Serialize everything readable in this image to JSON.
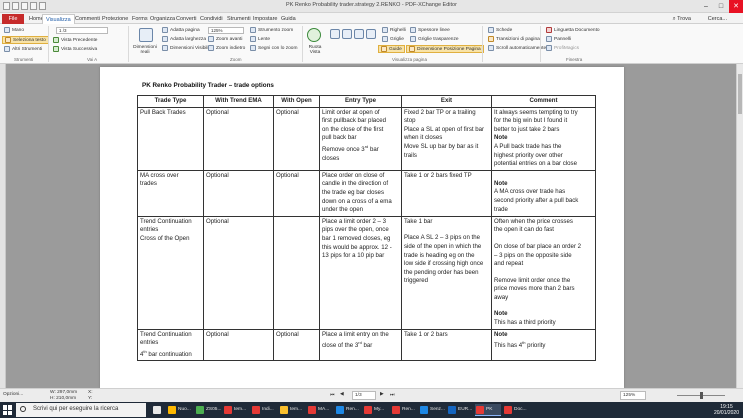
{
  "window": {
    "title": "PK Renko Probability trader.strategy 2.RENKO - PDF-XChange Editor",
    "tabs": [
      "File",
      "Home",
      "Visualizza",
      "Commenti",
      "Protezione",
      "Forms",
      "Organizza",
      "Converti",
      "Condividi",
      "Strumenti",
      "Impostare",
      "Guida"
    ],
    "search_label": "Cerca...",
    "find_label": "Trova"
  },
  "ribbon": {
    "tools": [
      {
        "label": "Mano",
        "icon": "hand-icon"
      },
      {
        "label": "Seleziona testo",
        "icon": "text-select-icon",
        "highlighted": true
      },
      {
        "label": "Altri Strumenti",
        "icon": "more-tools-icon"
      },
      {
        "label": "Vista Precedente",
        "icon": "previous-view-icon"
      },
      {
        "label": "Vista Successiva",
        "icon": "next-view-icon"
      }
    ],
    "page_field": "1",
    "page_total": "/3",
    "zoom_buttons": [
      {
        "label": "Adatta pagina",
        "icon": "fit-page-icon"
      },
      {
        "label": "Adatta larghezza",
        "icon": "fit-width-icon"
      },
      {
        "label": "Dimensioni Visibili",
        "icon": "fit-visible-icon"
      },
      {
        "label": "Zoom avanti",
        "icon": "zoom-in-icon"
      },
      {
        "label": "Zoom indietro",
        "icon": "zoom-out-icon"
      },
      {
        "label": "Strumento zoom",
        "icon": "zoom-tool-icon"
      },
      {
        "label": "Lente",
        "icon": "loupe-icon"
      },
      {
        "label": "Segni con lo zoom",
        "icon": "snapshot-zoom-icon"
      }
    ],
    "zoom_value": "125%",
    "dim_reali": "Dimensioni reali",
    "rotate_view": "Ruota Vista",
    "page_display": [
      {
        "label": "Righelli",
        "icon": "rulers-icon"
      },
      {
        "label": "Griglie",
        "icon": "grid-icon"
      },
      {
        "label": "Guide",
        "icon": "guides-icon",
        "highlighted": true
      },
      {
        "label": "Spessore linee",
        "icon": "line-weight-icon"
      },
      {
        "label": "Griglie trasparenze",
        "icon": "transparency-grid-icon"
      },
      {
        "label": "Dimensione Posizione Pagina",
        "icon": "page-position-icon",
        "highlighted": true
      }
    ],
    "navigation": [
      {
        "label": "Schede",
        "icon": "tabs-icon"
      },
      {
        "label": "Transizioni di pagina",
        "icon": "page-transitions-icon"
      },
      {
        "label": "Scroll automaticamente",
        "icon": "auto-scroll-icon"
      }
    ],
    "panels": [
      {
        "label": "Linguetta Documento",
        "icon": "doc-tab-icon"
      },
      {
        "label": "Pannelli",
        "icon": "panels-icon"
      },
      {
        "label": "ProfiMagics",
        "icon": "profile-icon"
      }
    ],
    "group_labels": [
      "Strumenti",
      "Vai A",
      "Zoom",
      "Visualizza pagina",
      "Finestra"
    ]
  },
  "document": {
    "title": "PK Renko Probability Trader – trade options",
    "headers": [
      "Trade Type",
      "With Trend EMA",
      "With Open",
      "Entry Type",
      "Exit",
      "Comment"
    ],
    "rows": [
      {
        "type": [
          "Pull Back Trades"
        ],
        "ema": "Optional",
        "open": "Optional",
        "entry": [
          "Limit order at open of",
          "first pullback bar placed",
          "on the close of the first",
          "pull back bar",
          "Remove once 3rd bar",
          "closes"
        ],
        "exit": [
          "Fixed 2 bar TP or a trailing",
          "stop",
          "Place a SL at open of first bar",
          "when it closes",
          "Move SL up bar by bar as it",
          "trails"
        ],
        "comment": [
          "It always seems tempting to try",
          "for the big win but I found it",
          "better to just take 2 bars",
          "Note",
          "A Pull back trade has the",
          "highest priority over other",
          "potential entries on a bar close"
        ]
      },
      {
        "type": [
          "MA cross over",
          "trades"
        ],
        "ema": "Optional",
        "open": "Optional",
        "entry": [
          "Place order on close of",
          "candle in the direction of",
          "the trade eg bar closes",
          "down on a cross of a ema",
          "under the open"
        ],
        "exit": [
          "Take 1 or 2 bars fixed TP"
        ],
        "comment": [
          "",
          "Note",
          "A MA cross over trade has",
          "second priority after a pull back",
          "trade"
        ]
      },
      {
        "type": [
          "Trend Continuation",
          "entries",
          "Cross of the Open"
        ],
        "ema": "Optional",
        "open": "",
        "entry": [
          "Place a limit order 2 – 3",
          "pips over the open, once",
          "bar 1 removed closes, eg",
          "this would be approx. 12 -",
          "13 pips for a 10 pip bar"
        ],
        "exit": [
          "Take 1 bar",
          "",
          "Place A SL 2 – 3 pips on the",
          "side of the open in which the",
          "trade is heading eg on the",
          "low side if crossing high once",
          "the pending order has been",
          "triggered"
        ],
        "comment": [
          "Often when the price crosses",
          "the open it can do fast",
          "",
          "On close of bar place an order 2",
          "– 3 pips on the opposite side",
          "and repeat",
          "",
          "Remove limit order once the",
          "price moves more than 2 bars",
          "away",
          "",
          "Note",
          "This has a third priority"
        ]
      },
      {
        "type": [
          "Trend Continuation",
          "entries",
          "4th bar continuation"
        ],
        "ema": "Optional",
        "open": "Optional",
        "entry": [
          "Place a limit entry on the",
          "close of the 3rd bar"
        ],
        "exit": [
          "Take 1 or 2 bars"
        ],
        "comment": [
          "Note",
          " This has 4th priority"
        ]
      }
    ]
  },
  "statusbar": {
    "options": "Opzioni...",
    "width": "W: 297,0mm",
    "height": "H: 210,0mm",
    "x": "X:",
    "y": "Y:",
    "page": "1",
    "page_total": "/3",
    "zoom": "125%"
  },
  "taskbar": {
    "search_placeholder": "Scrivi qui per eseguire la ricerca",
    "apps": [
      {
        "label": "",
        "color": "#e8e8e8"
      },
      {
        "label": "Nuo...",
        "color": "#ffb900"
      },
      {
        "label": "ZS05...",
        "color": "#4caf50"
      },
      {
        "label": "tem...",
        "color": "#e53935"
      },
      {
        "label": "Indi...",
        "color": "#e53935"
      },
      {
        "label": "tem...",
        "color": "#fbc02d"
      },
      {
        "label": "MA...",
        "color": "#e53935"
      },
      {
        "label": "Ren...",
        "color": "#1e88e5"
      },
      {
        "label": "My...",
        "color": "#e53935"
      },
      {
        "label": "Ren...",
        "color": "#e53935"
      },
      {
        "label": "Senz...",
        "color": "#1e88e5"
      },
      {
        "label": "EUR...",
        "color": "#1565c0"
      },
      {
        "label": "PK R...",
        "color": "#e53935"
      },
      {
        "label": "Doc...",
        "color": "#e53935"
      }
    ],
    "time": "19:15",
    "date": "20/01/2020"
  }
}
